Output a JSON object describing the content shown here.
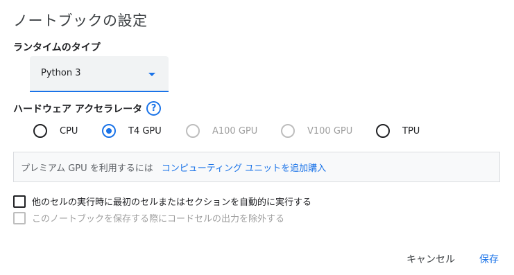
{
  "dialog": {
    "title": "ノートブックの設定"
  },
  "runtime": {
    "label": "ランタイムのタイプ",
    "selected": "Python 3"
  },
  "accelerator": {
    "label": "ハードウェア アクセラレータ",
    "help_icon": "?",
    "options": [
      {
        "label": "CPU",
        "checked": false,
        "disabled": false
      },
      {
        "label": "T4 GPU",
        "checked": true,
        "disabled": false
      },
      {
        "label": "A100 GPU",
        "checked": false,
        "disabled": true
      },
      {
        "label": "V100 GPU",
        "checked": false,
        "disabled": true
      },
      {
        "label": "TPU",
        "checked": false,
        "disabled": false
      }
    ]
  },
  "promo": {
    "text": "プレミアム GPU を利用するには",
    "link": "コンピューティング ユニットを追加購入"
  },
  "checkboxes": [
    {
      "label": "他のセルの実行時に最初のセルまたはセクションを自動的に実行する",
      "checked": false,
      "disabled": false
    },
    {
      "label": "このノートブックを保存する際にコードセルの出力を除外する",
      "checked": false,
      "disabled": true
    }
  ],
  "actions": {
    "cancel": "キャンセル",
    "save": "保存"
  },
  "colors": {
    "accent": "#1a73e8",
    "disabled": "#bdbdbd"
  }
}
